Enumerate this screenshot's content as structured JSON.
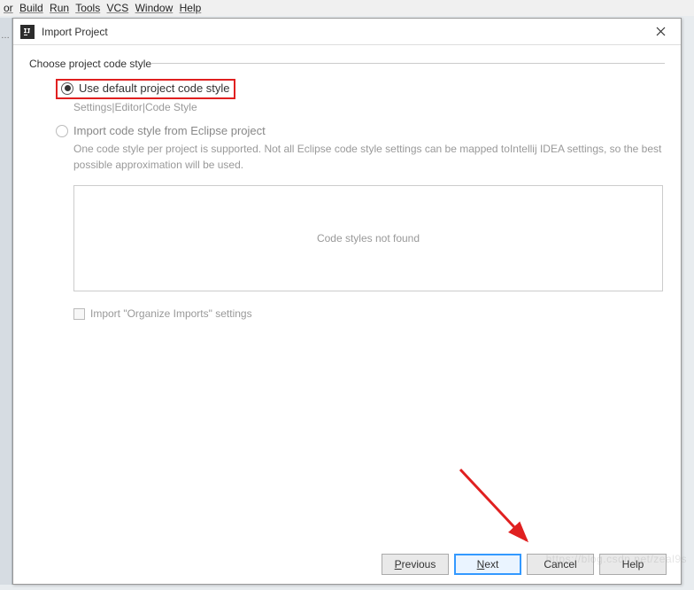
{
  "menubar": {
    "items": [
      "or",
      "Build",
      "Run",
      "Tools",
      "VCS",
      "Window",
      "Help"
    ]
  },
  "dialog": {
    "title": "Import Project",
    "fieldset_label": "Choose project code style",
    "option1": {
      "label": "Use default project code style",
      "hint": "Settings|Editor|Code Style"
    },
    "option2": {
      "label": "Import code style from Eclipse project",
      "desc": "One code style per project is supported. Not all Eclipse code style settings can be mapped toIntellij IDEA settings, so the best possible approximation will be used."
    },
    "empty_message": "Code styles not found",
    "checkbox_label": "Import \"Organize Imports\" settings",
    "buttons": {
      "previous": "Previous",
      "next": "Next",
      "cancel": "Cancel",
      "help": "Help"
    }
  },
  "watermark": "https://blog.csdn.net/zeal9s"
}
